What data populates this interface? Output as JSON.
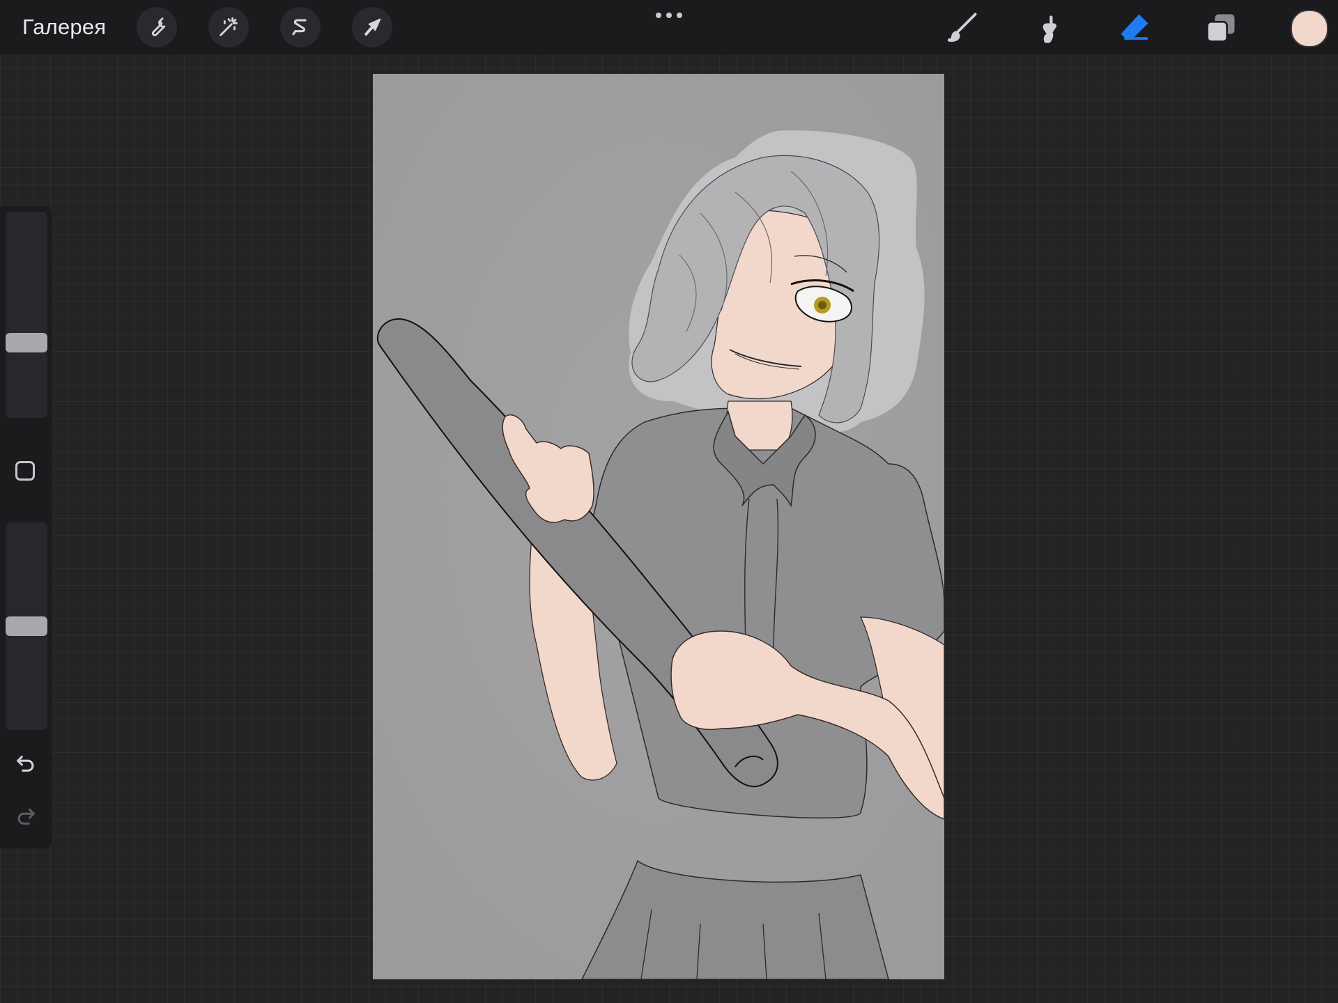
{
  "topbar": {
    "gallery_label": "Галерея",
    "left_tools": [
      {
        "name": "actions",
        "icon": "wrench-icon"
      },
      {
        "name": "adjustments",
        "icon": "magic-wand-icon"
      },
      {
        "name": "selection",
        "icon": "selection-s-icon"
      },
      {
        "name": "transform",
        "icon": "arrow-cursor-icon"
      }
    ],
    "more_icon": "ellipsis-icon",
    "right_tools": [
      {
        "name": "brush",
        "icon": "brush-icon",
        "active": false
      },
      {
        "name": "smudge",
        "icon": "smudge-icon",
        "active": false
      },
      {
        "name": "eraser",
        "icon": "eraser-icon",
        "active": true
      },
      {
        "name": "layers",
        "icon": "layers-icon",
        "active": false
      }
    ],
    "current_color": "#f2d7cb"
  },
  "sidebar": {
    "brush_size_level": 0.35,
    "opacity_level": 0.5,
    "modifier_icon": "square-icon",
    "undo_icon": "undo-icon",
    "redo_icon": "redo-icon"
  },
  "colors": {
    "accent": "#1e7bf0",
    "canvas_background": "#a09fa1",
    "skin": "#f2d7cb",
    "hair": "#b3b3b6",
    "shirt": "#8f8f92"
  }
}
